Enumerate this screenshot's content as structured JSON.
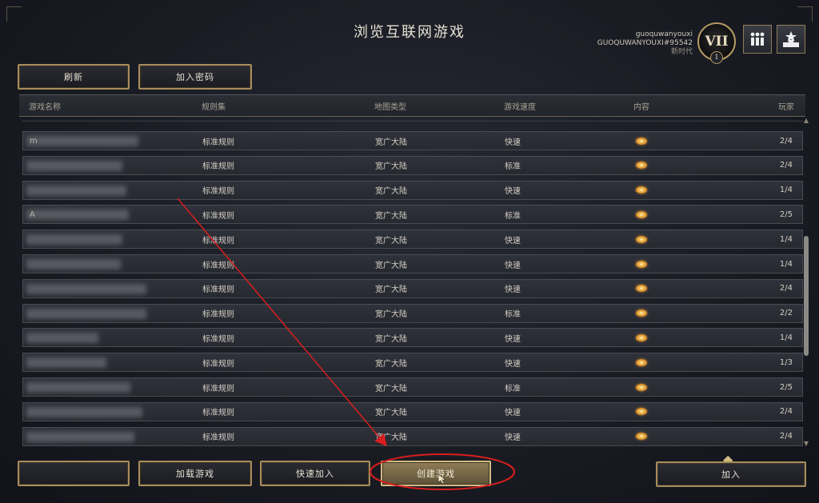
{
  "page": {
    "title": "浏览互联网游戏"
  },
  "user": {
    "name": "guoquwanyouxi",
    "tag": "GUOQUWANYOUXI#95542",
    "era": "新时代",
    "badge_numeral": "VII",
    "badge_level": "1"
  },
  "top_icons": [
    "social-icon",
    "leaderboard-icon"
  ],
  "toolbar": {
    "refresh_label": "刷新",
    "join_code_label": "加入密码"
  },
  "columns": {
    "name": "游戏名称",
    "ruleset": "规则集",
    "map": "地图类型",
    "speed": "游戏速度",
    "content": "内容",
    "players": "玩家"
  },
  "games": [
    {
      "name": "m",
      "ruleset": "标准规则",
      "map": "宽广大陆",
      "speed": "快速",
      "players": "2/4"
    },
    {
      "name": "",
      "ruleset": "标准规则",
      "map": "宽广大陆",
      "speed": "标准",
      "players": "2/4"
    },
    {
      "name": "",
      "ruleset": "标准规则",
      "map": "宽广大陆",
      "speed": "快速",
      "players": "1/4"
    },
    {
      "name": "A",
      "ruleset": "标准规则",
      "map": "宽广大陆",
      "speed": "标准",
      "players": "2/5"
    },
    {
      "name": "",
      "ruleset": "标准规则",
      "map": "宽广大陆",
      "speed": "快速",
      "players": "1/4"
    },
    {
      "name": "",
      "ruleset": "标准规则",
      "map": "宽广大陆",
      "speed": "快速",
      "players": "1/4"
    },
    {
      "name": "",
      "ruleset": "标准规则",
      "map": "宽广大陆",
      "speed": "快速",
      "players": "2/4"
    },
    {
      "name": "",
      "ruleset": "标准规则",
      "map": "宽广大陆",
      "speed": "标准",
      "players": "2/2"
    },
    {
      "name": "",
      "ruleset": "标准规则",
      "map": "宽广大陆",
      "speed": "快速",
      "players": "1/4"
    },
    {
      "name": "",
      "ruleset": "标准规则",
      "map": "宽广大陆",
      "speed": "快速",
      "players": "1/3"
    },
    {
      "name": "",
      "ruleset": "标准规则",
      "map": "宽广大陆",
      "speed": "标准",
      "players": "2/5"
    },
    {
      "name": "",
      "ruleset": "标准规则",
      "map": "宽广大陆",
      "speed": "快速",
      "players": "2/4"
    },
    {
      "name": "",
      "ruleset": "标准规则",
      "map": "宽广大陆",
      "speed": "快速",
      "players": "2/4"
    }
  ],
  "bottom": {
    "load_label": "加载游戏",
    "quick_join_label": "快速加入",
    "create_label": "创建游戏",
    "join_label": "加入"
  },
  "colors": {
    "annotation": "#d81e1e",
    "gold_border": "#a68d5c",
    "content_coin": "#e7a43a"
  }
}
